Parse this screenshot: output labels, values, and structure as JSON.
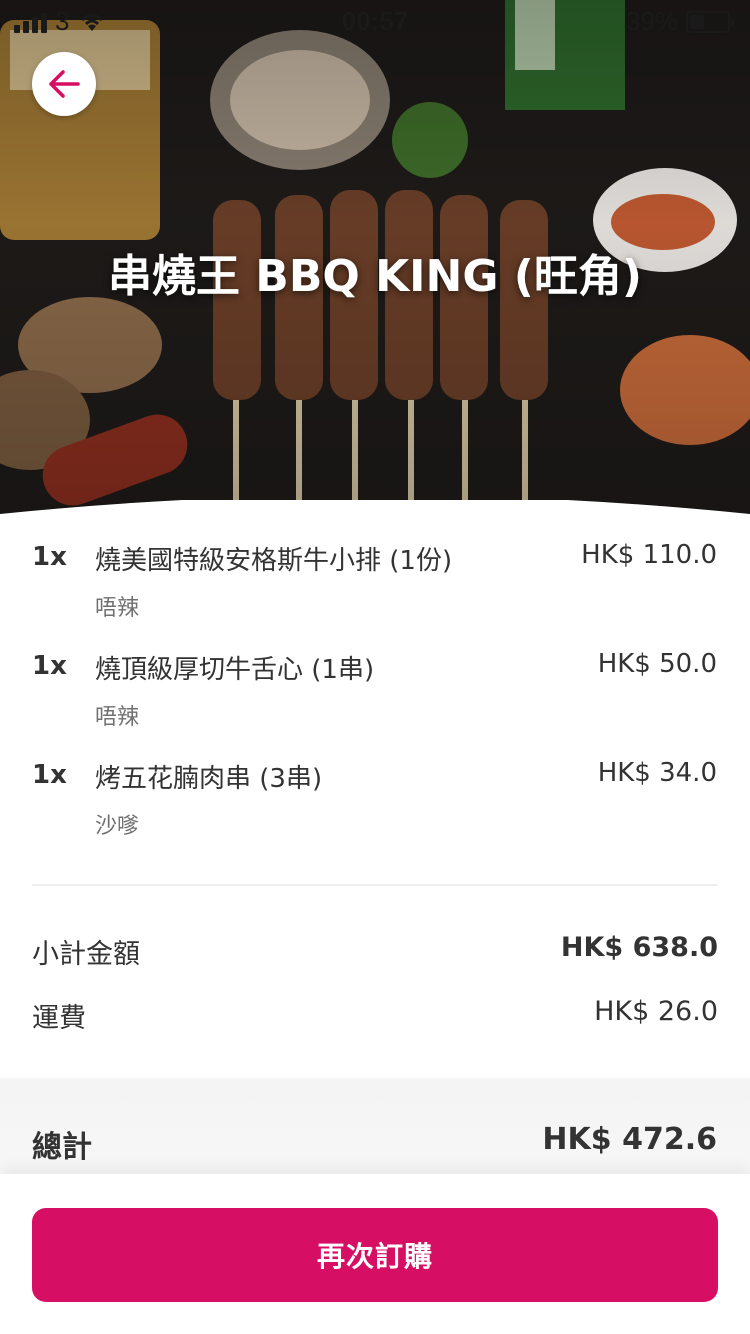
{
  "status_bar": {
    "carrier": "3",
    "time": "00:57",
    "battery": "39%",
    "battery_level": 0.39
  },
  "header": {
    "restaurant_name": "串燒王 BBQ KING (旺角)"
  },
  "order": {
    "items": [
      {
        "qty": "1x",
        "name": "燒美國特級安格斯牛小排 (1份)",
        "option": "唔辣",
        "price": "HK$ 110.0"
      },
      {
        "qty": "1x",
        "name": "燒頂級厚切牛舌心 (1串)",
        "option": "唔辣",
        "price": "HK$ 50.0"
      },
      {
        "qty": "1x",
        "name": "烤五花腩肉串 (3串)",
        "option": "沙嗲",
        "price": "HK$ 34.0"
      }
    ]
  },
  "summary": {
    "subtotal_label": "小計金額",
    "subtotal_value": "HK$ 638.0",
    "delivery_label": "運費",
    "delivery_value": "HK$ 26.0",
    "total_label": "總計",
    "total_value": "HK$ 472.6"
  },
  "actions": {
    "reorder_label": "再次訂購"
  },
  "colors": {
    "brand": "#d70f64",
    "text": "#333333",
    "muted": "#707070"
  }
}
